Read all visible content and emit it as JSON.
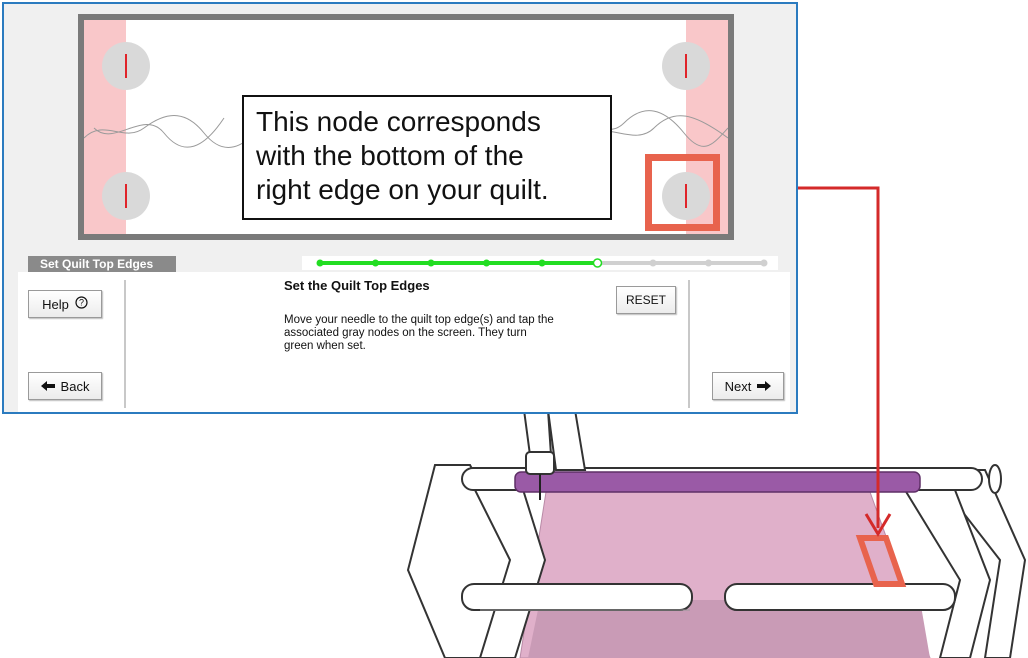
{
  "callout": {
    "line1": "This node corresponds",
    "line2": "with the bottom of the",
    "line3": "right edge on your quilt."
  },
  "panel": {
    "section_tab": "Set Quilt Top Edges",
    "step_title": "Set the Quilt Top Edges",
    "instructions": "Move your needle to the quilt top edge(s) and tap the associated gray nodes on the screen. They turn green when set.",
    "help_label": "Help",
    "reset_label": "RESET",
    "back_label": "Back",
    "next_label": "Next",
    "progress": {
      "total_steps": 9,
      "completed_steps": 5,
      "current_step": 6
    }
  },
  "icons": {
    "help": "question-circle-icon",
    "back": "arrow-left-icon",
    "next": "arrow-right-icon"
  },
  "colors": {
    "window_border": "#2b7bbf",
    "progress_done": "#22dd22",
    "progress_todo": "#d0d0d0",
    "edge_band": "#f9c7c9",
    "node": "#d9d9d9",
    "node_mark": "#e0242a",
    "highlight": "#e8634d",
    "connector": "#d42a2a",
    "quilt": "#e0b0ca",
    "roller": "#9a5aa6"
  }
}
